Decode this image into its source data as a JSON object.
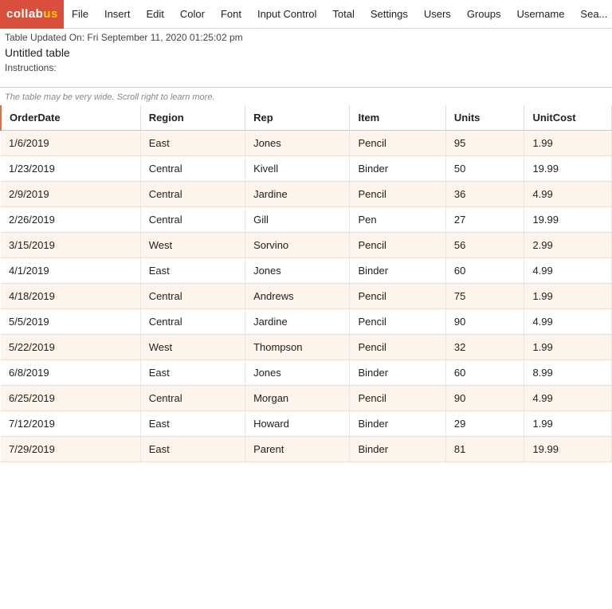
{
  "logo": {
    "collab": "collab",
    "us": "us"
  },
  "nav": {
    "items": [
      {
        "label": "File"
      },
      {
        "label": "Insert"
      },
      {
        "label": "Edit"
      },
      {
        "label": "Color"
      },
      {
        "label": "Font"
      },
      {
        "label": "Input Control"
      },
      {
        "label": "Total"
      },
      {
        "label": "Settings"
      },
      {
        "label": "Users"
      },
      {
        "label": "Groups"
      },
      {
        "label": "Username"
      },
      {
        "label": "Sea..."
      }
    ]
  },
  "info": {
    "updated": "Table Updated On: Fri September 11, 2020 01:25:02 pm",
    "title": "Untitled table",
    "instructions_label": "Instructions:"
  },
  "scroll_hint": "The table may be very wide. Scroll right to learn more.",
  "table": {
    "columns": [
      {
        "key": "orderdate",
        "label": "OrderDate"
      },
      {
        "key": "region",
        "label": "Region"
      },
      {
        "key": "rep",
        "label": "Rep"
      },
      {
        "key": "item",
        "label": "Item"
      },
      {
        "key": "units",
        "label": "Units"
      },
      {
        "key": "unitcost",
        "label": "UnitCost"
      }
    ],
    "rows": [
      {
        "orderdate": "1/6/2019",
        "region": "East",
        "rep": "Jones",
        "item": "Pencil",
        "units": "95",
        "unitcost": "1.99"
      },
      {
        "orderdate": "1/23/2019",
        "region": "Central",
        "rep": "Kivell",
        "item": "Binder",
        "units": "50",
        "unitcost": "19.99"
      },
      {
        "orderdate": "2/9/2019",
        "region": "Central",
        "rep": "Jardine",
        "item": "Pencil",
        "units": "36",
        "unitcost": "4.99"
      },
      {
        "orderdate": "2/26/2019",
        "region": "Central",
        "rep": "Gill",
        "item": "Pen",
        "units": "27",
        "unitcost": "19.99"
      },
      {
        "orderdate": "3/15/2019",
        "region": "West",
        "rep": "Sorvino",
        "item": "Pencil",
        "units": "56",
        "unitcost": "2.99"
      },
      {
        "orderdate": "4/1/2019",
        "region": "East",
        "rep": "Jones",
        "item": "Binder",
        "units": "60",
        "unitcost": "4.99"
      },
      {
        "orderdate": "4/18/2019",
        "region": "Central",
        "rep": "Andrews",
        "item": "Pencil",
        "units": "75",
        "unitcost": "1.99"
      },
      {
        "orderdate": "5/5/2019",
        "region": "Central",
        "rep": "Jardine",
        "item": "Pencil",
        "units": "90",
        "unitcost": "4.99"
      },
      {
        "orderdate": "5/22/2019",
        "region": "West",
        "rep": "Thompson",
        "item": "Pencil",
        "units": "32",
        "unitcost": "1.99"
      },
      {
        "orderdate": "6/8/2019",
        "region": "East",
        "rep": "Jones",
        "item": "Binder",
        "units": "60",
        "unitcost": "8.99"
      },
      {
        "orderdate": "6/25/2019",
        "region": "Central",
        "rep": "Morgan",
        "item": "Pencil",
        "units": "90",
        "unitcost": "4.99"
      },
      {
        "orderdate": "7/12/2019",
        "region": "East",
        "rep": "Howard",
        "item": "Binder",
        "units": "29",
        "unitcost": "1.99"
      },
      {
        "orderdate": "7/29/2019",
        "region": "East",
        "rep": "Parent",
        "item": "Binder",
        "units": "81",
        "unitcost": "19.99"
      }
    ]
  }
}
